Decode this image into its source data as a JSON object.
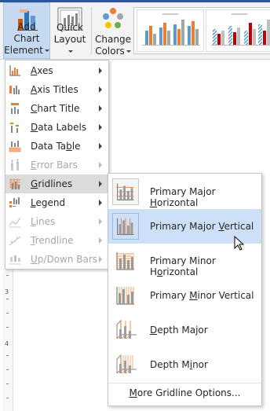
{
  "ribbon": {
    "add_chart_element": {
      "line1": "Add Chart",
      "line2": "Element"
    },
    "quick_layout": {
      "line1": "Quick",
      "line2": "Layout"
    },
    "change_colors": {
      "line1": "Change",
      "line2": "Colors"
    },
    "colors": {
      "accent": "#2b579a",
      "active_button": "#c5daf0",
      "hover_item": "#cde0f7"
    }
  },
  "ruler": {
    "numbers": [
      "3",
      "4"
    ]
  },
  "menu": {
    "items": [
      {
        "pre": "",
        "mn": "A",
        "post": "xes",
        "icon": "axes-icon",
        "disabled": false
      },
      {
        "pre": "",
        "mn": "A",
        "post": "xis Titles",
        "icon": "axis-titles-icon",
        "disabled": false
      },
      {
        "pre": "",
        "mn": "C",
        "post": "hart Title",
        "icon": "chart-title-icon",
        "disabled": false
      },
      {
        "pre": "",
        "mn": "D",
        "post": "ata Labels",
        "icon": "data-labels-icon",
        "disabled": false
      },
      {
        "pre": "Data Ta",
        "mn": "b",
        "post": "le",
        "icon": "data-table-icon",
        "disabled": false
      },
      {
        "pre": "",
        "mn": "E",
        "post": "rror Bars",
        "icon": "error-bars-icon",
        "disabled": true
      },
      {
        "pre": "",
        "mn": "G",
        "post": "ridlines",
        "icon": "gridlines-icon",
        "disabled": false,
        "selected": true
      },
      {
        "pre": "",
        "mn": "L",
        "post": "egend",
        "icon": "legend-icon",
        "disabled": false
      },
      {
        "pre": "",
        "mn": "L",
        "post": "ines",
        "icon": "lines-icon",
        "disabled": true
      },
      {
        "pre": "",
        "mn": "T",
        "post": "rendline",
        "icon": "trendline-icon",
        "disabled": true
      },
      {
        "pre": "",
        "mn": "U",
        "post": "p/Down Bars",
        "icon": "up-down-bars-icon",
        "disabled": true
      }
    ]
  },
  "submenu": {
    "items": [
      {
        "pre": "Primary Major ",
        "mn": "H",
        "post": "orizontal",
        "icon": "primary-major-horizontal-icon"
      },
      {
        "pre": "Primary Major ",
        "mn": "V",
        "post": "ertical",
        "icon": "primary-major-vertical-icon",
        "hover": true
      },
      {
        "pre": "Primary Minor H",
        "mn": "o",
        "post": "rizontal",
        "icon": "primary-minor-horizontal-icon"
      },
      {
        "pre": "Primary ",
        "mn": "M",
        "post": "inor Vertical",
        "icon": "primary-minor-vertical-icon"
      },
      {
        "pre": "",
        "mn": "D",
        "post": "epth Major",
        "icon": "depth-major-icon"
      },
      {
        "pre": "Depth M",
        "mn": "i",
        "post": "nor",
        "icon": "depth-minor-icon"
      }
    ],
    "more": {
      "pre": "",
      "mn": "M",
      "post": "ore Gridline Options..."
    }
  }
}
